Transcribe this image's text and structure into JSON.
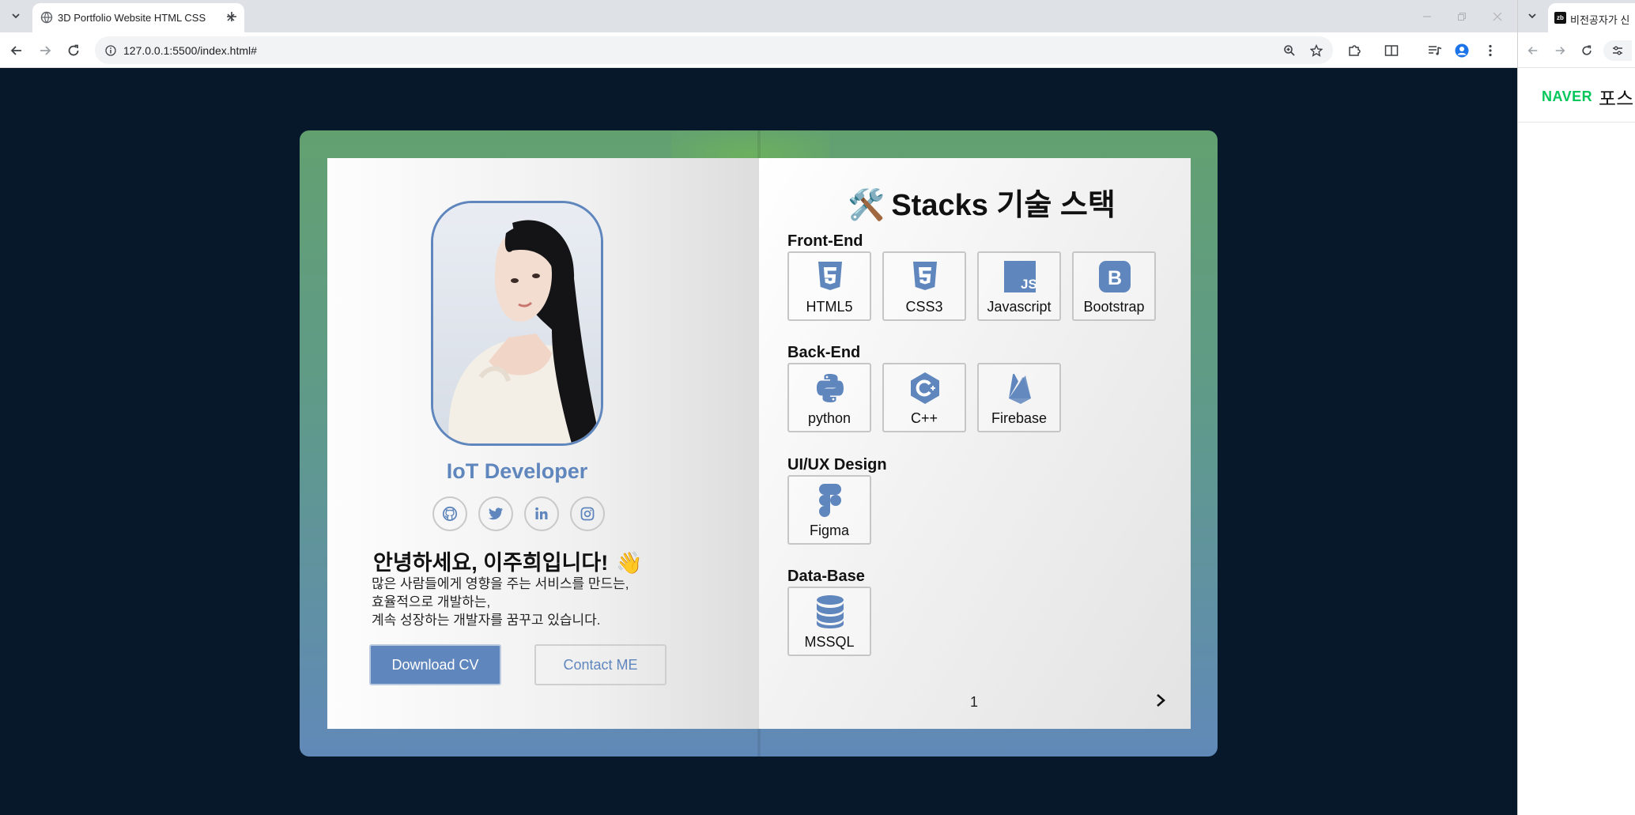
{
  "browser": {
    "tab_title": "3D Portfolio Website HTML CSS",
    "url": "127.0.0.1:5500/index.html#"
  },
  "profile": {
    "role": "IoT Developer",
    "greeting": "안녕하세요, 이주희입니다!",
    "wave_emoji": "👋",
    "description": [
      "많은 사람들에게 영향을 주는 서비스를 만드는,",
      "효율적으로 개발하는,",
      "계속 성장하는 개발자를 꿈꾸고 있습니다."
    ],
    "download_label": "Download CV",
    "contact_label": "Contact ME",
    "socials": [
      "github-icon",
      "twitter-icon",
      "linkedin-icon",
      "instagram-icon"
    ]
  },
  "stacks": {
    "title_emoji": "🛠️",
    "title": "Stacks 기술 스택",
    "sections": [
      {
        "title": "Front-End",
        "items": [
          {
            "label": "HTML5",
            "icon": "html5-icon"
          },
          {
            "label": "CSS3",
            "icon": "css3-icon"
          },
          {
            "label": "Javascript",
            "icon": "javascript-icon"
          },
          {
            "label": "Bootstrap",
            "icon": "bootstrap-icon"
          }
        ]
      },
      {
        "title": "Back-End",
        "items": [
          {
            "label": "python",
            "icon": "python-icon"
          },
          {
            "label": "C++",
            "icon": "cplusplus-icon"
          },
          {
            "label": "Firebase",
            "icon": "firebase-icon"
          }
        ]
      },
      {
        "title": "UI/UX Design",
        "items": [
          {
            "label": "Figma",
            "icon": "figma-icon"
          }
        ]
      },
      {
        "title": "Data-Base",
        "items": [
          {
            "label": "MSSQL",
            "icon": "database-icon"
          }
        ]
      }
    ],
    "page_number": "1"
  },
  "second_window": {
    "tab_title": "비전공자가 신",
    "favicon_text": "zb",
    "naver_logo": "NAVER",
    "post_text": "포스"
  },
  "colors": {
    "accent": "#5f86bd",
    "background": "#06182a",
    "book_top": "#63a070",
    "book_bottom": "#6189b8"
  }
}
